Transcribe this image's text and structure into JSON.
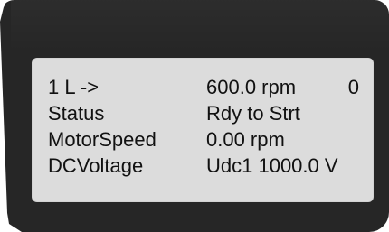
{
  "display": {
    "rows": [
      {
        "label": "1 L ->",
        "value": "600.0 rpm",
        "extra": "0"
      },
      {
        "label": "Status",
        "value": "Rdy to Strt"
      },
      {
        "label": "MotorSpeed",
        "value": "0.00 rpm"
      },
      {
        "label": "DCVoltage",
        "value": "Udc1 1000.0 V"
      }
    ]
  },
  "colors": {
    "bezel": "#262626",
    "screen": "#dcdcdc",
    "text": "#111111"
  }
}
